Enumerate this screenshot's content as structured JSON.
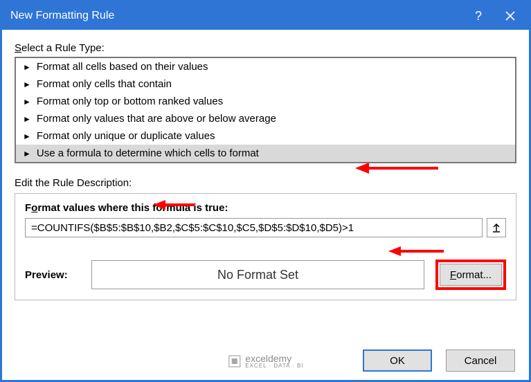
{
  "title": "New Formatting Rule",
  "select_label_pre": "S",
  "select_label_rest": "elect a Rule Type:",
  "rule_types": [
    "Format all cells based on their values",
    "Format only cells that contain",
    "Format only top or bottom ranked values",
    "Format only values that are above or below average",
    "Format only unique or duplicate values",
    "Use a formula to determine which cells to format"
  ],
  "selected_rule_index": 5,
  "edit_label": "Edit the Rule Description:",
  "formula_label_pre": "F",
  "formula_label_mid": "o",
  "formula_label_rest": "rmat values where this formula is true:",
  "formula_value": "=COUNTIFS($B$5:$B$10,$B2,$C$5:$C$10,$C5,$D$5:$D$10,$D5)>1",
  "preview_label": "Preview:",
  "preview_text": "No Format Set",
  "format_btn_pre": "F",
  "format_btn_rest": "ormat...",
  "ok_label": "OK",
  "cancel_label": "Cancel",
  "watermark": {
    "name": "exceldemy",
    "sub": "EXCEL · DATA · BI"
  }
}
